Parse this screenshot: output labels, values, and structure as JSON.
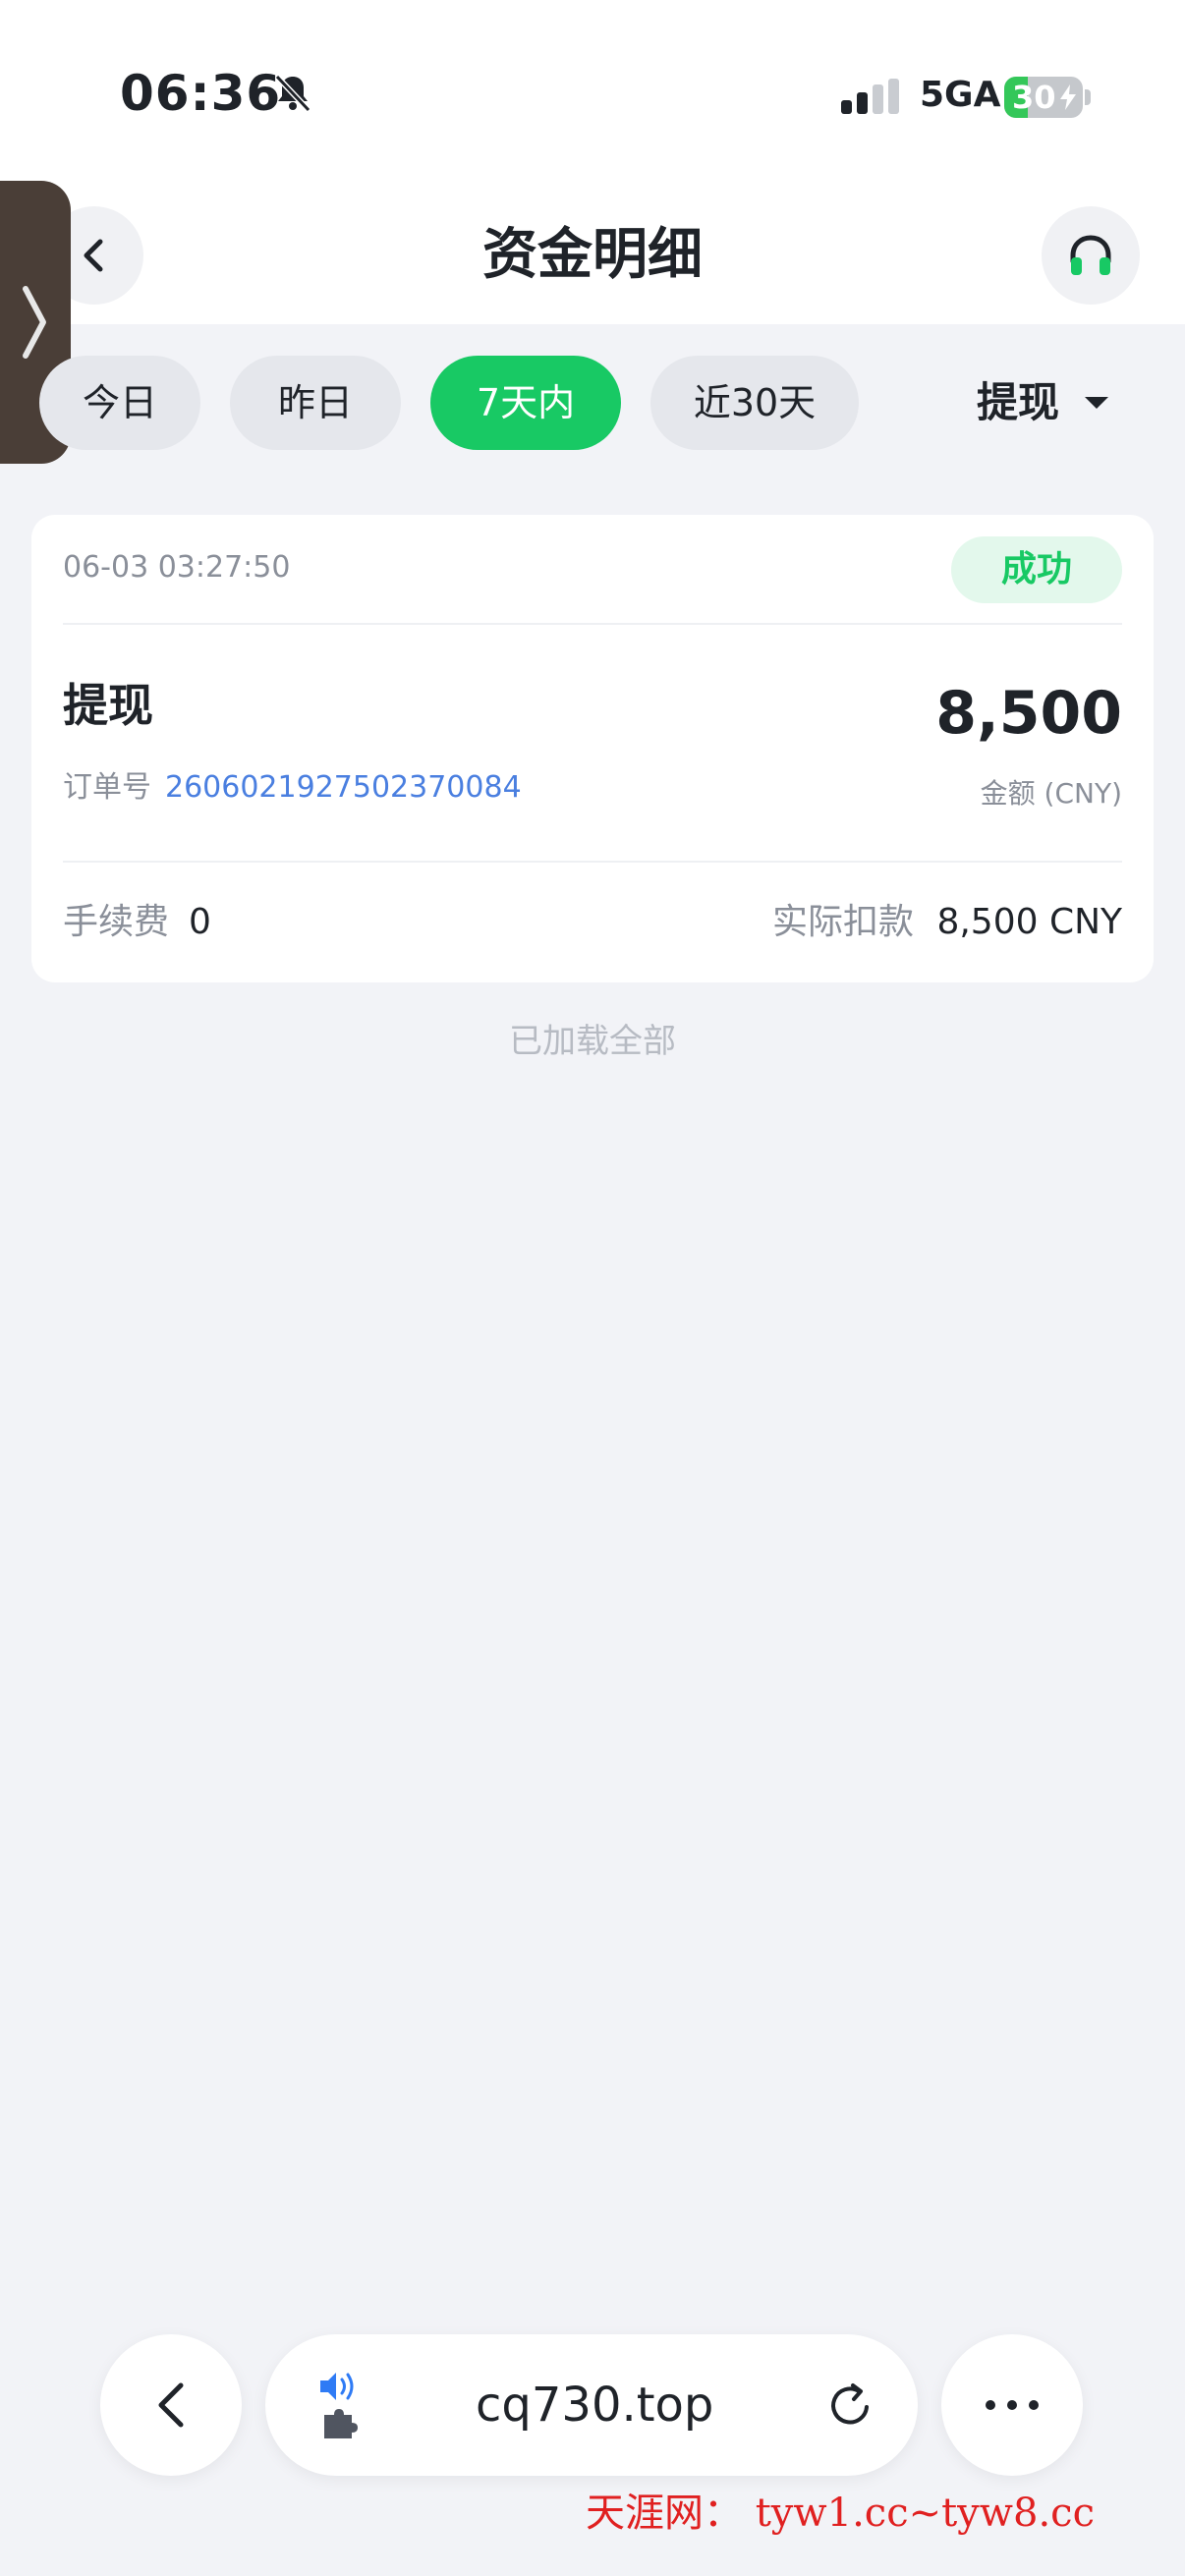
{
  "status_bar": {
    "time": "06:36",
    "network": "5GA",
    "battery_level": "30",
    "battery_fraction": 0.3,
    "icons": [
      "bell-slash-icon",
      "signal-icon",
      "bolt-icon"
    ]
  },
  "header": {
    "title": "资金明细",
    "back_icon": "chevron-left-icon",
    "support_icon": "headphones-icon"
  },
  "edge_tab_icon": "chevron-right-icon",
  "filters": {
    "items": [
      "今日",
      "昨日",
      "7天内",
      "近30天"
    ],
    "active": "7天内",
    "type_select": "提现",
    "type_select_icon": "caret-down-icon"
  },
  "record": {
    "time": "06-03 03:27:50",
    "status": "成功",
    "type": "提现",
    "order_label": "订单号",
    "order_number": "2606021927502370084",
    "amount": "8,500",
    "amount_label": "金额 (CNY)",
    "fee_label": "手续费",
    "fee_value": "0",
    "deduct_label": "实际扣款",
    "deduct_value": "8,500 CNY"
  },
  "list_footer": "已加载全部",
  "browser_bar": {
    "url": "cq730.top",
    "icons": [
      "chevron-left-icon",
      "speaker-icon",
      "puzzle-icon",
      "reload-icon",
      "more-icon"
    ]
  },
  "watermark": "天涯网： tyw1.cc~tyw8.cc",
  "colors": {
    "accent": "#18c964",
    "link": "#4a7fe0",
    "background": "#f2f3f7",
    "watermark": "#e02020"
  }
}
